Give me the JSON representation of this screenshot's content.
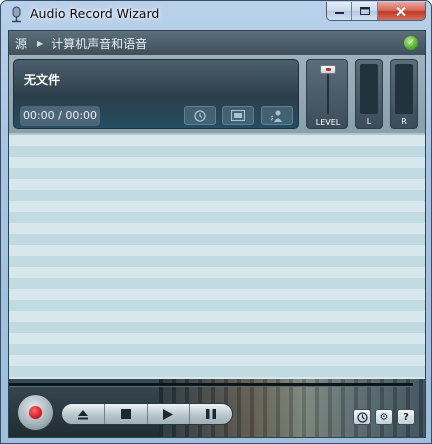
{
  "window": {
    "title": "Audio Record Wizard"
  },
  "breadcrumb": {
    "source": "源",
    "item": "计算机声音和语音"
  },
  "file": {
    "name": "无文件",
    "time": "00:00 / 00:00"
  },
  "level": {
    "label": "LEVEL"
  },
  "meters": {
    "left": "L",
    "right": "R"
  },
  "icons": {
    "app": "microphone-icon",
    "ok": "check-icon",
    "timer": "clock-icon",
    "film": "film-icon",
    "voice": "voice-icon",
    "record": "record-icon",
    "eject": "eject-icon",
    "stop": "stop-icon",
    "play": "play-icon",
    "pause": "pause-icon",
    "schedule": "clock-icon",
    "settings": "gear-icon",
    "help": "help-icon"
  },
  "colors": {
    "accent": "#d0101a",
    "ok": "#4fb226"
  }
}
